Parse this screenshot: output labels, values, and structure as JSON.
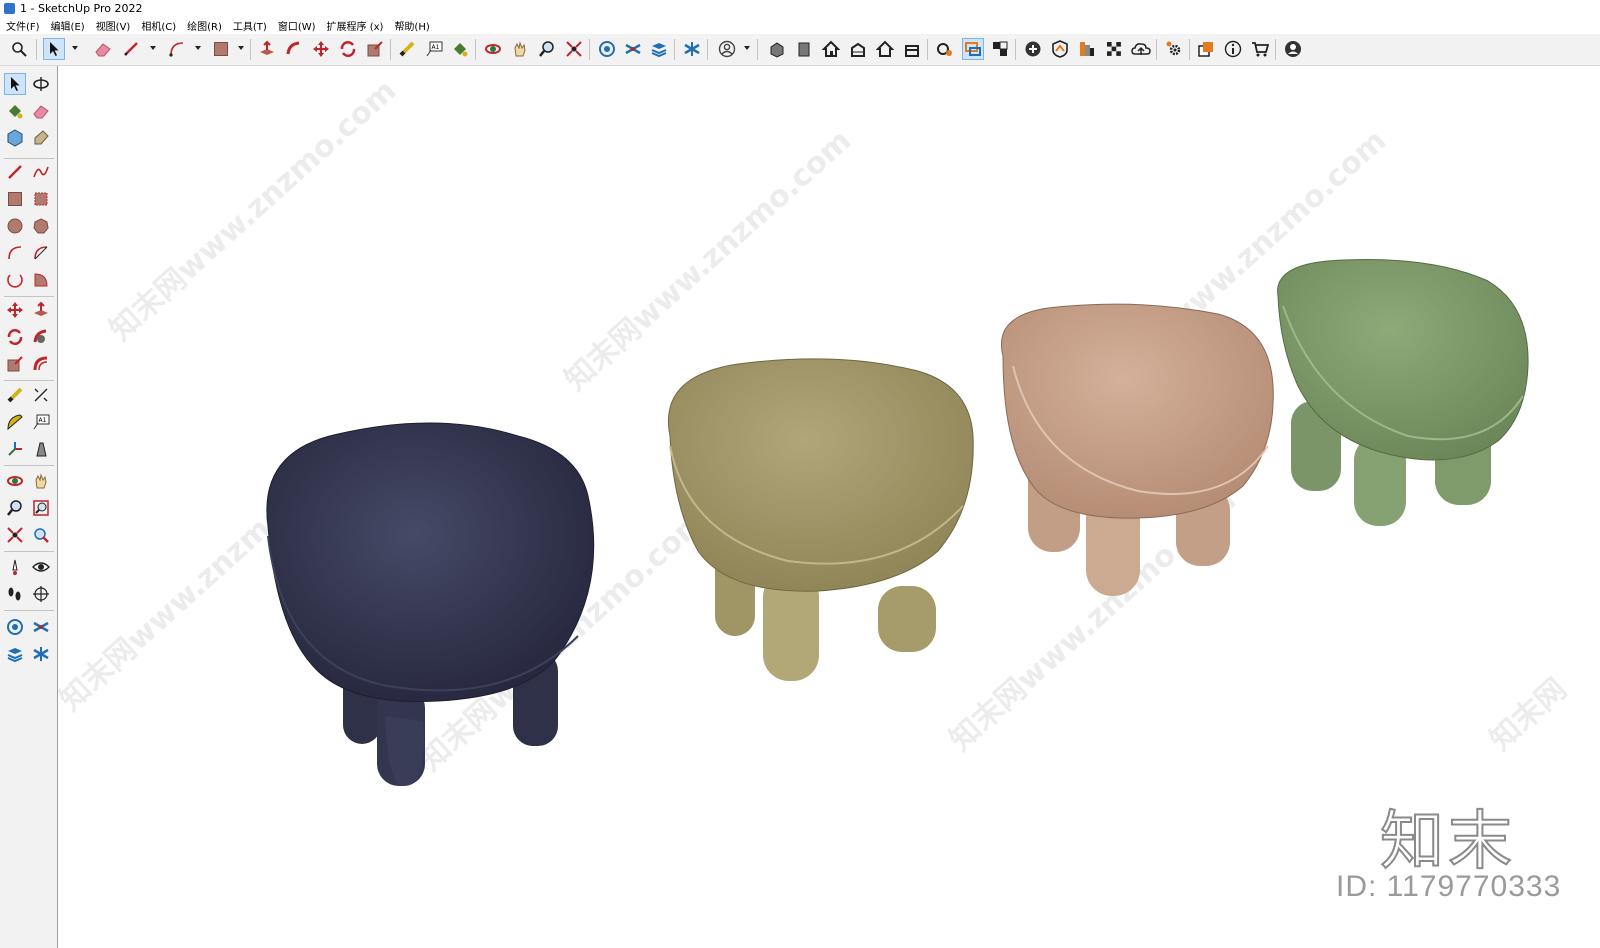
{
  "window": {
    "title": "1 - SketchUp Pro 2022"
  },
  "menu": [
    "文件(F)",
    "编辑(E)",
    "视图(V)",
    "相机(C)",
    "绘图(R)",
    "工具(T)",
    "窗口(W)",
    "扩展程序 (x)",
    "帮助(H)"
  ],
  "toolbar": {
    "icons": [
      "search-icon",
      "select-icon",
      "eraser-icon",
      "pencil-icon",
      "arc-icon",
      "rectangle-icon",
      "push-pull-icon",
      "follow-me-icon",
      "move-icon",
      "rotate-icon",
      "scale-icon",
      "tape-measure-icon",
      "text-icon",
      "paint-bucket-icon",
      "orbit-icon",
      "pan-icon",
      "zoom-icon",
      "zoom-extents-icon",
      "3d-warehouse-icon",
      "extension-warehouse-icon",
      "layout-icon",
      "sandbox-icon",
      "user-icon",
      "iso-view-icon",
      "top-view-icon",
      "front-view-icon",
      "right-view-icon",
      "back-view-icon",
      "left-view-icon",
      "section-plane-icon",
      "section-display-icon",
      "section-fill-icon",
      "add-location-icon",
      "geo-terrain-icon",
      "materials-icon",
      "styles-icon",
      "cloud-icon",
      "settings-icon",
      "components-icon",
      "info-icon",
      "shop-icon",
      "profile-icon"
    ]
  },
  "sidebar": {
    "icons": [
      "select-icon",
      "orbit-icon",
      "paint-bucket-icon",
      "eraser-icon",
      "component-icon",
      "tag-icon",
      "pencil-icon",
      "freehand-icon",
      "rectangle-icon",
      "rotated-rectangle-icon",
      "circle-icon",
      "polygon-icon",
      "arc-icon",
      "pie-icon",
      "arc-3pt-icon",
      "arc-2pt-icon",
      "move-icon",
      "push-pull-icon",
      "rotate-icon",
      "follow-me-icon",
      "scale-icon",
      "offset-icon",
      "tape-measure-icon",
      "dimension-icon",
      "protractor-icon",
      "text-icon",
      "axes-icon",
      "3d-text-icon",
      "orbit-icon",
      "pan-icon",
      "zoom-icon",
      "zoom-window-icon",
      "zoom-extents-icon",
      "previous-view-icon",
      "position-camera-icon",
      "look-around-icon",
      "walk-icon",
      "section-plane-icon",
      "warehouse-icon",
      "extension-icon",
      "layers-icon",
      "sandbox-icon"
    ]
  },
  "watermarks": [
    "知末网www.znzmo.com",
    "知末网www.znzmo.com",
    "知末网www.znzmo.com",
    "知末网www.znzmo.com",
    "知末网www.znzmo.com",
    "知末网www.znzmo.com",
    "知末网"
  ],
  "brand": {
    "logo": "知末",
    "id_text": "ID: 1179770333"
  },
  "chairs": [
    {
      "name": "navy-chair",
      "color": "#2d2f45"
    },
    {
      "name": "olive-chair",
      "color": "#a49a6c"
    },
    {
      "name": "tan-chair",
      "color": "#c8a48b"
    },
    {
      "name": "green-chair",
      "color": "#7f9a69"
    }
  ]
}
